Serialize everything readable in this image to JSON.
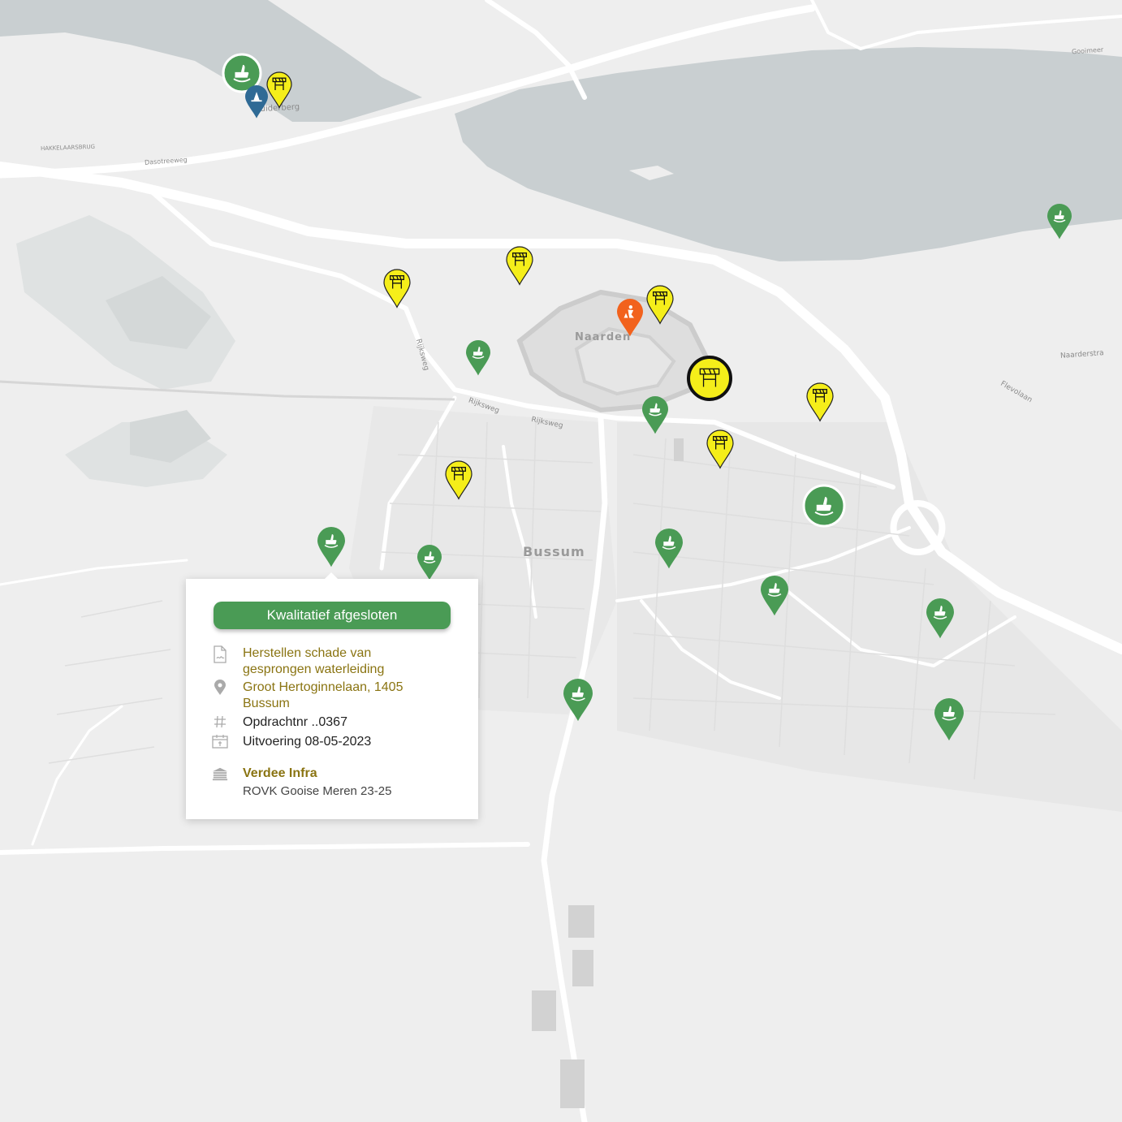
{
  "map": {
    "place_labels": [
      {
        "name": "label-naarden",
        "text": "Naarden"
      },
      {
        "name": "label-bussum",
        "text": "Bussum"
      },
      {
        "name": "label-muiderberg",
        "text": "Muiderberg"
      },
      {
        "name": "label-rijksweg-1",
        "text": "Rijksweg"
      },
      {
        "name": "label-rijksweg-2",
        "text": "Rijksweg"
      },
      {
        "name": "label-rijksweg-3",
        "text": "Rijksweg"
      },
      {
        "name": "label-naarderstraat",
        "text": "Naarderstra"
      },
      {
        "name": "label-flevolaan",
        "text": "Flevolaan"
      },
      {
        "name": "label-dasotreeweg",
        "text": "Dasotreeweg"
      },
      {
        "name": "label-hakkelaarsbrug",
        "text": "HAKKELAARSBRUG"
      },
      {
        "name": "label-gooimeer",
        "text": "Gooimeer"
      }
    ],
    "marker_colors": {
      "green": "#4a9b55",
      "yellow": "#f5ee1a",
      "orange": "#f2621d",
      "blue": "#2f6a95",
      "selected_ring": "#111111"
    },
    "marker_types": {
      "green": "hand-thumbs-up-icon",
      "yellow": "road-barrier-icon",
      "orange": "road-worker-icon",
      "blue": "traffic-cone-icon"
    }
  },
  "popup": {
    "status_label": "Kwalitatief afgesloten",
    "status_color": "#4a9b55",
    "description_line1": "Herstellen schade van",
    "description_line2": "gesprongen waterleiding",
    "address_line1": "Groot Hertoginnelaan, 1405",
    "address_line2": "Bussum",
    "order_number": "Opdrachtnr ..0367",
    "execution_date": "Uitvoering 08-05-2023",
    "contractor": "Verdee Infra",
    "contract": "ROVK Gooise Meren 23-25",
    "icons": [
      "document-signature-icon",
      "location-pin-icon",
      "hash-icon",
      "calendar-icon",
      "company-building-icon"
    ]
  }
}
